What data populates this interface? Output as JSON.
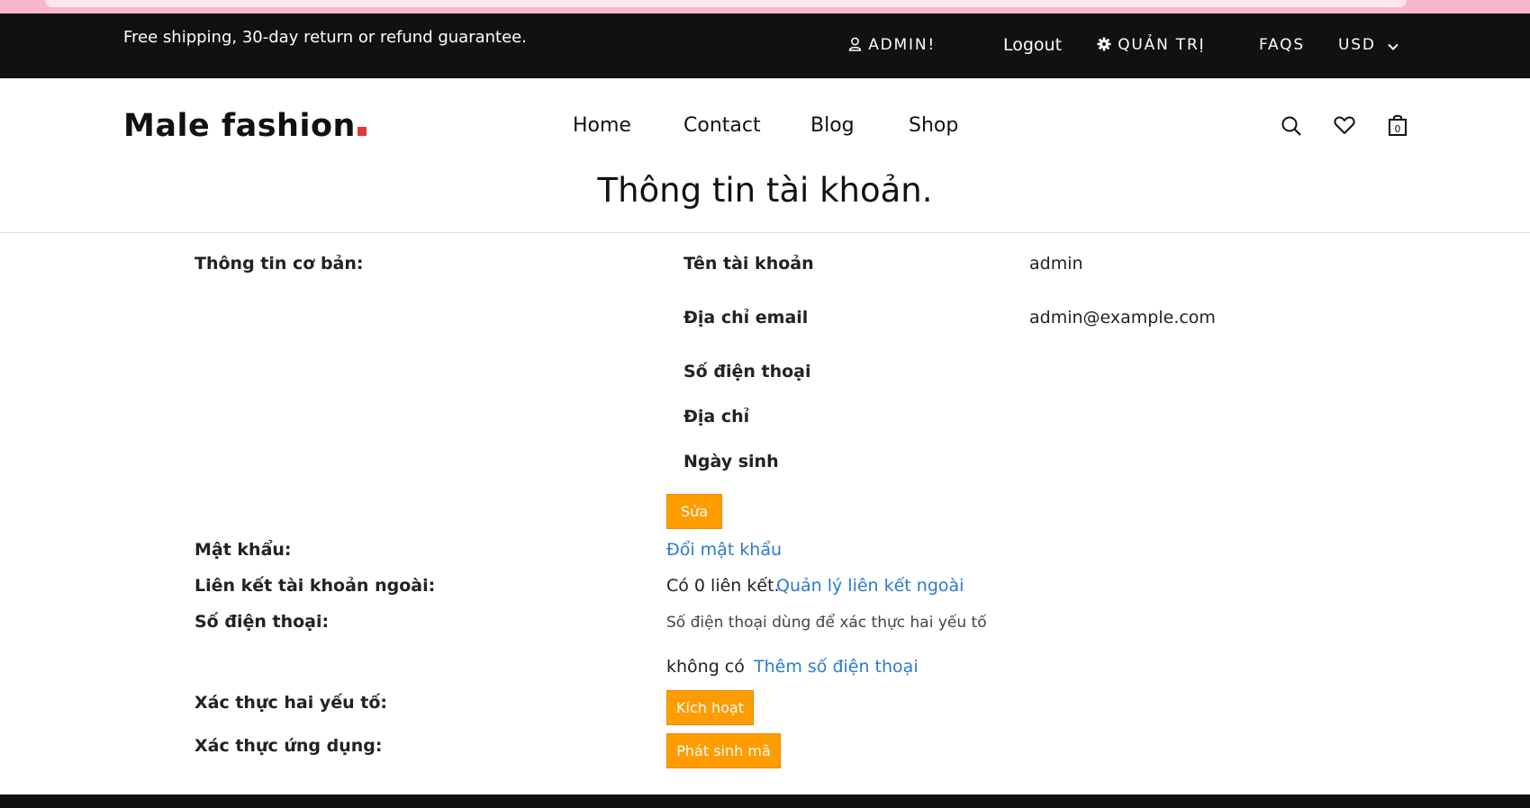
{
  "topbar": {
    "shipping_note": "Free shipping, 30-day return or refund guarantee.",
    "user_label": "ADMIN!",
    "logout_label": "Logout",
    "admin_label": "QUẢN TRỊ",
    "faqs_label": "FAQS",
    "currency_label": "USD"
  },
  "header": {
    "logo_text": "Male fashion",
    "nav": [
      "Home",
      "Contact",
      "Blog",
      "Shop"
    ],
    "cart_count": "0",
    "icons": [
      "search-icon",
      "heart-icon",
      "cart-icon"
    ]
  },
  "page": {
    "title": "Thông tin tài khoản."
  },
  "basic": {
    "section_label": "Thông tin cơ bản:",
    "username_label": "Tên tài khoản",
    "username_value": "admin",
    "email_label": "Địa chỉ email",
    "email_value": "admin@example.com",
    "phone_label": "Số điện thoại",
    "address_label": "Địa chỉ",
    "birthday_label": "Ngày sinh",
    "edit_button": "Sửa"
  },
  "password": {
    "label": "Mật khẩu:",
    "change_link": "Đổi mật khẩu"
  },
  "external": {
    "label": "Liên kết tài khoản ngoài:",
    "count_text": "Có 0 liên kết.",
    "manage_link": "Quản lý liên kết ngoài"
  },
  "phone": {
    "label": "Số điện thoại:",
    "description": "Số điện thoại dùng để xác thực hai yếu tố",
    "status": "không có",
    "add_link": "Thêm số điện thoại"
  },
  "twofactor": {
    "label": "Xác thực hai yếu tố:",
    "activate_button": "Kích hoạt"
  },
  "app_auth": {
    "label": "Xác thực ứng dụng:",
    "generate_button": "Phát sinh mã"
  },
  "colors": {
    "accent": "#ff9c00",
    "link": "#2a7ad1",
    "dark": "#111111",
    "logo_dot": "#e53637"
  }
}
